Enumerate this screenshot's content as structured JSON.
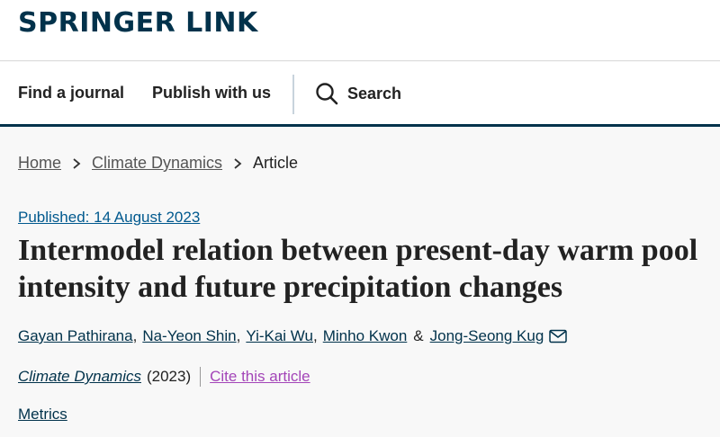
{
  "header": {
    "logo": "SPRINGER LINK"
  },
  "nav": {
    "find_journal": "Find a journal",
    "publish": "Publish with us",
    "search": "Search",
    "search_icon": "search-icon"
  },
  "breadcrumb": {
    "home": "Home",
    "journal": "Climate Dynamics",
    "current": "Article"
  },
  "article": {
    "published": "Published: 14 August 2023",
    "title": "Intermodel relation between present-day warm pool intensity and future precipitation changes",
    "authors": [
      "Gayan Pathirana",
      "Na-Yeon Shin",
      "Yi-Kai Wu",
      "Minho Kwon",
      "Jong-Seong Kug"
    ],
    "author_separator": ",",
    "author_last_joiner": "&",
    "journal": "Climate Dynamics",
    "year": "(2023)",
    "cite": "Cite this article",
    "metrics": "Metrics"
  },
  "colors": {
    "brand": "#01324b",
    "link": "#01598e",
    "cite": "#a345b8"
  }
}
